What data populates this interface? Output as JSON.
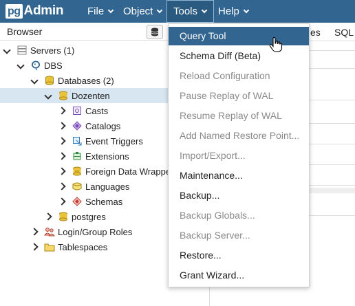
{
  "app": {
    "logo_pg": "pg",
    "logo_admin": "Admin"
  },
  "menubar": [
    {
      "label": "File"
    },
    {
      "label": "Object"
    },
    {
      "label": "Tools"
    },
    {
      "label": "Help"
    }
  ],
  "browser": {
    "title": "Browser",
    "toolbar_icon": "database-icon"
  },
  "tree": {
    "servers": "Servers (1)",
    "dbs": "DBS",
    "databases": "Databases (2)",
    "dozenten": "Dozenten",
    "casts": "Casts",
    "catalogs": "Catalogs",
    "event_triggers": "Event Triggers",
    "extensions": "Extensions",
    "fdw": "Foreign Data Wrappers",
    "languages": "Languages",
    "schemas": "Schemas",
    "postgres": "postgres",
    "roles": "Login/Group Roles",
    "tablespaces": "Tablespaces"
  },
  "right_tabs": {
    "partial": "es",
    "sql": "SQL"
  },
  "tools_menu": {
    "items": [
      {
        "label": "Query Tool",
        "enabled": true,
        "highlighted": true
      },
      {
        "label": "Schema Diff (Beta)",
        "enabled": true
      },
      {
        "label": "Reload Configuration",
        "enabled": false
      },
      {
        "label": "Pause Replay of WAL",
        "enabled": false
      },
      {
        "label": "Resume Replay of WAL",
        "enabled": false
      },
      {
        "label": "Add Named Restore Point...",
        "enabled": false
      },
      {
        "label": "Import/Export...",
        "enabled": false
      },
      {
        "label": "Maintenance...",
        "enabled": true
      },
      {
        "label": "Backup...",
        "enabled": true
      },
      {
        "label": "Backup Globals...",
        "enabled": false
      },
      {
        "label": "Backup Server...",
        "enabled": false
      },
      {
        "label": "Restore...",
        "enabled": true
      },
      {
        "label": "Grant Wizard...",
        "enabled": true
      }
    ]
  },
  "colors": {
    "header": "#326690",
    "selected_row": "#d8e6f1",
    "disabled_text": "#8a8a8a"
  }
}
